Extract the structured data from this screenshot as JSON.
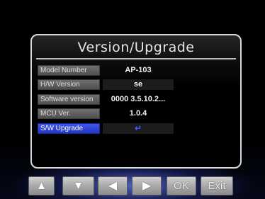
{
  "dialog": {
    "title": "Version/Upgrade",
    "rows": [
      {
        "label": "Model Number",
        "value": "AP-103"
      },
      {
        "label": "H/W Version",
        "value": "se"
      },
      {
        "label": "Software version",
        "value": "0000 3.5.10.2..."
      },
      {
        "label": "MCU Ver.",
        "value": "1.0.4"
      },
      {
        "label": "S/W Upgrade",
        "value_icon": "enter-return-icon",
        "value": "↵"
      }
    ],
    "selected_row": "S/W Upgrade"
  },
  "controls": {
    "up": "▲",
    "down": "▼",
    "left": "◀",
    "right": "▶",
    "ok": "OK",
    "exit": "Exit"
  },
  "colors": {
    "selected_row": "#2a3fd6",
    "label_bg": "#5f5f5f",
    "panel_border": "#d8d8d8"
  }
}
